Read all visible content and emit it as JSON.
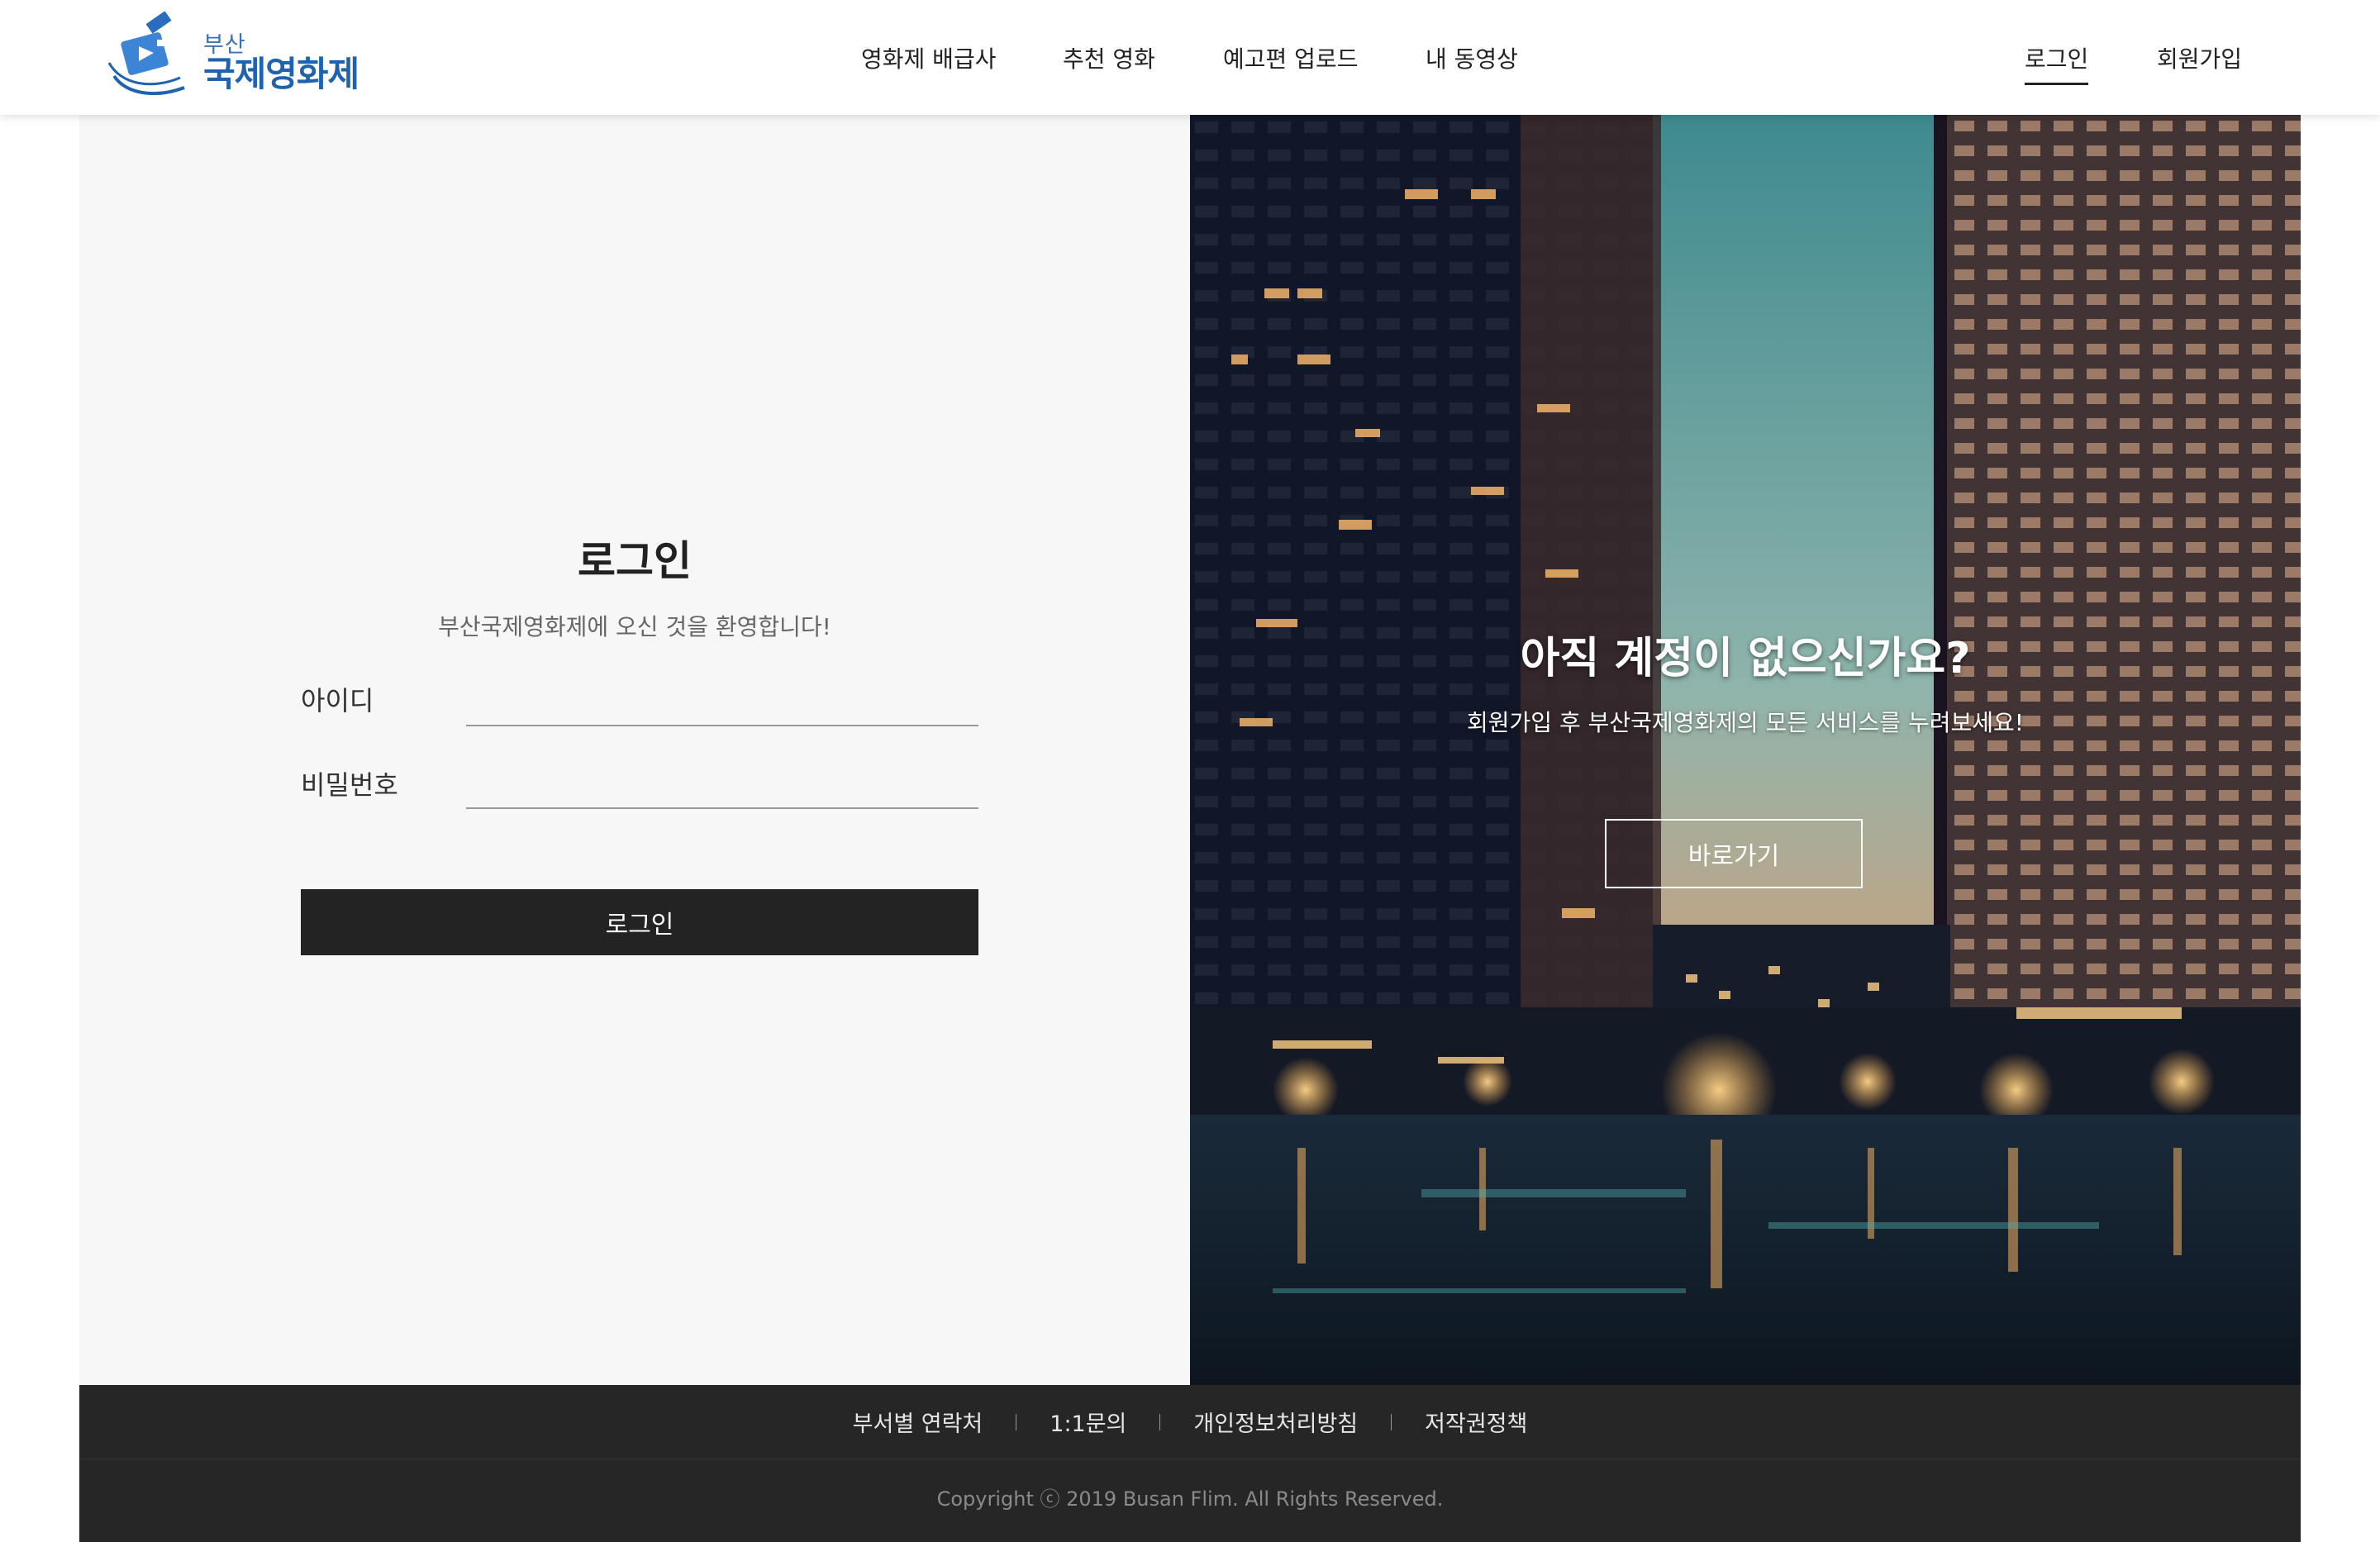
{
  "logo": {
    "small_text": "부산",
    "big_text": "국제영화제"
  },
  "nav": {
    "items": [
      "영화제 배급사",
      "추천 영화",
      "예고편 업로드",
      "내 동영상"
    ],
    "login": "로그인",
    "signup": "회원가입"
  },
  "login": {
    "title": "로그인",
    "subtitle": "부산국제영화제에 오신 것을 환영합니다!",
    "id_label": "아이디",
    "id_value": "",
    "password_label": "비밀번호",
    "password_value": "",
    "button": "로그인"
  },
  "promo": {
    "title": "아직 계정이 없으신가요?",
    "subtitle": "회원가입 후 부산국제영화제의 모든 서비스를 누려보세요!",
    "button": "바로가기"
  },
  "footer": {
    "links": [
      "부서별 연락처",
      "1:1문의",
      "개인정보처리방침",
      "저작권정책"
    ],
    "copyright": "Copyright ⓒ 2019 Busan Flim. All Rights Reserved."
  },
  "colors": {
    "brand": "#1f63b0",
    "button_dark": "#232323",
    "footer_bg": "#262626",
    "panel_bg": "#f7f7f7"
  }
}
